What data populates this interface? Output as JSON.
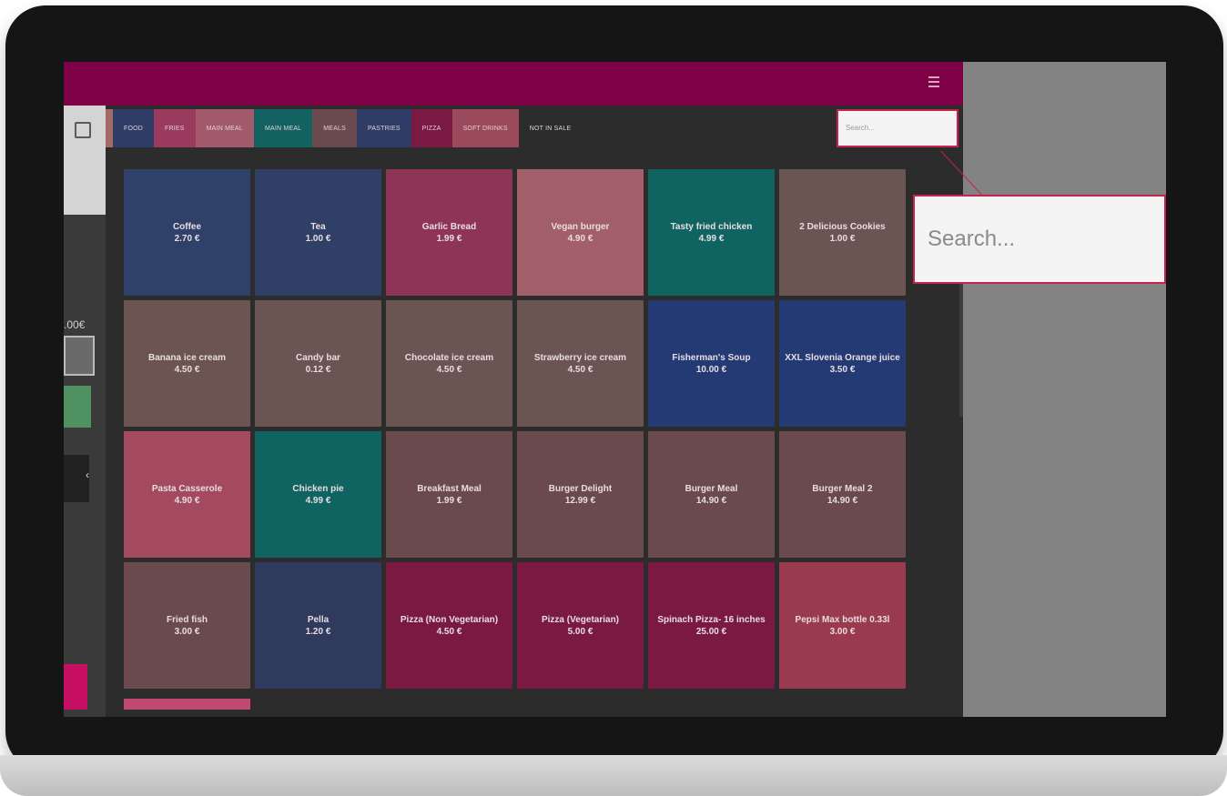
{
  "left_panel": {
    "total": ".00€",
    "arrow": "‹"
  },
  "tabs": [
    {
      "label": "FOOD",
      "color": "#2f3c66"
    },
    {
      "label": "FRIES",
      "color": "#9a3a5c"
    },
    {
      "label": "MAIN MEAL",
      "color": "#a35a6a"
    },
    {
      "label": "MAIN MEAL",
      "color": "#126262"
    },
    {
      "label": "MEALS",
      "color": "#6a4a4e"
    },
    {
      "label": "PASTRIES",
      "color": "#2f3c66"
    },
    {
      "label": "PIZZA",
      "color": "#7a1a44"
    },
    {
      "label": "SOFT DRINKS",
      "color": "#9a4a5a"
    },
    {
      "label": "NOT IN SALE",
      "color": "#2c2c2c"
    }
  ],
  "search": {
    "placeholder": "Search...",
    "zoom_placeholder": "Search..."
  },
  "products": [
    {
      "name": "Coffee",
      "price": "2.70 €",
      "color": "#2f4169"
    },
    {
      "name": "Tea",
      "price": "1.00 €",
      "color": "#2f3f66"
    },
    {
      "name": "Garlic Bread",
      "price": "1.99 €",
      "color": "#8e3557"
    },
    {
      "name": "Vegan burger",
      "price": "4.90 €",
      "color": "#a25f6a"
    },
    {
      "name": "Tasty fried chicken",
      "price": "4.99 €",
      "color": "#0f6462"
    },
    {
      "name": "2 Delicious Cookies",
      "price": "1.00 €",
      "color": "#6a5552"
    },
    {
      "name": "Banana ice cream",
      "price": "4.50 €",
      "color": "#6c5550"
    },
    {
      "name": "Candy bar",
      "price": "0.12 €",
      "color": "#6a5552"
    },
    {
      "name": "Chocolate ice cream",
      "price": "4.50 €",
      "color": "#6a5552"
    },
    {
      "name": "Strawberry ice cream",
      "price": "4.50 €",
      "color": "#6a5552"
    },
    {
      "name": "Fisherman's Soup",
      "price": "10.00 €",
      "color": "#243a74"
    },
    {
      "name": "XXL Slovenia Orange juice",
      "price": "3.50 €",
      "color": "#243a74"
    },
    {
      "name": "Pasta Casserole",
      "price": "4.90 €",
      "color": "#a34a5e"
    },
    {
      "name": "Chicken pie",
      "price": "4.99 €",
      "color": "#0f6462"
    },
    {
      "name": "Breakfast Meal",
      "price": "1.99 €",
      "color": "#6a4a4c"
    },
    {
      "name": "Burger Delight",
      "price": "12.99 €",
      "color": "#6a4a4c"
    },
    {
      "name": "Burger Meal",
      "price": "14.90 €",
      "color": "#6a4a4c"
    },
    {
      "name": "Burger Meal 2",
      "price": "14.90 €",
      "color": "#6a4a4c"
    },
    {
      "name": "Fried fish",
      "price": "3.00 €",
      "color": "#6a4a4c"
    },
    {
      "name": "Pella",
      "price": "1.20 €",
      "color": "#2f3a5e"
    },
    {
      "name": "Pizza (Non Vegetarian)",
      "price": "4.50 €",
      "color": "#7a1a42"
    },
    {
      "name": "Pizza (Vegetarian)",
      "price": "5.00 €",
      "color": "#7a1a42"
    },
    {
      "name": "Spinach Pizza- 16 inches",
      "price": "25.00 €",
      "color": "#7a1a42"
    },
    {
      "name": "Pepsi Max bottle 0.33l",
      "price": "3.00 €",
      "color": "#9a3a4e"
    }
  ]
}
